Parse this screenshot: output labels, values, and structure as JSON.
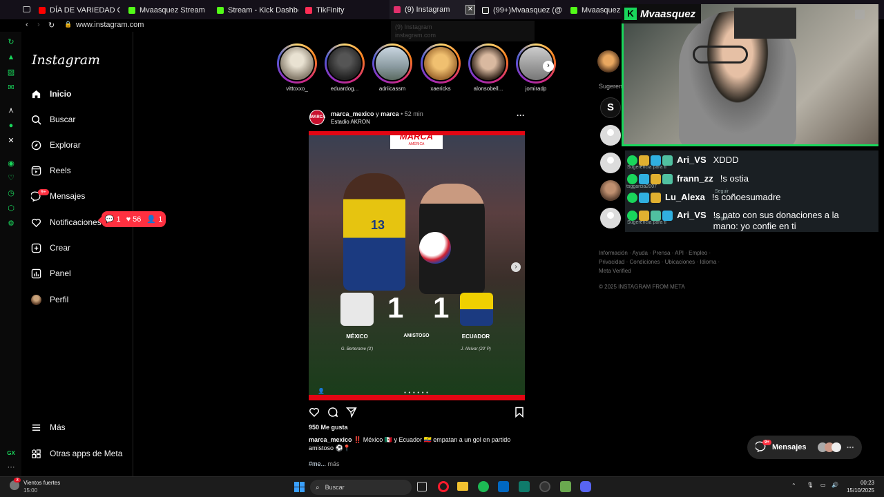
{
  "browser": {
    "tabs": [
      {
        "label": "DÍA DE VARIEDAD CARAJ",
        "icon": "youtube-icon",
        "color": "#ff0000"
      },
      {
        "label": "Mvaasquez Stream - Wat",
        "icon": "kick-icon",
        "color": "#53fc18"
      },
      {
        "label": "Stream - Kick Dashboard",
        "icon": "kick-icon",
        "color": "#53fc18"
      },
      {
        "label": "TikFinity",
        "icon": "tikfinity-icon",
        "color": "#ff2d55"
      },
      {
        "label": "(9) Instagram",
        "icon": "instagram-icon",
        "color": "#e1306c"
      },
      {
        "label": "(99+)Mvaasquez (@mvasq",
        "icon": "tiktok-icon",
        "color": "#ffffff"
      },
      {
        "label": "Mvaasquez Stre",
        "icon": "kick-icon",
        "color": "#53fc18"
      }
    ],
    "url": "www.instagram.com",
    "tab_hover_title": "(9) Instagram",
    "tab_hover_url": "instagram.com",
    "accent": "#18e66a"
  },
  "instagram": {
    "logo": "Instagram",
    "nav": [
      {
        "label": "Inicio",
        "icon": "home-icon"
      },
      {
        "label": "Buscar",
        "icon": "search-icon"
      },
      {
        "label": "Explorar",
        "icon": "compass-icon"
      },
      {
        "label": "Reels",
        "icon": "reels-icon"
      },
      {
        "label": "Mensajes",
        "icon": "messenger-icon"
      },
      {
        "label": "Notificaciones",
        "icon": "heart-icon"
      },
      {
        "label": "Crear",
        "icon": "plus-square-icon"
      },
      {
        "label": "Panel",
        "icon": "chart-icon"
      },
      {
        "label": "Perfil",
        "icon": "avatar-icon"
      },
      {
        "label": "Más",
        "icon": "menu-icon"
      },
      {
        "label": "Otras apps de Meta",
        "icon": "meta-apps-icon"
      }
    ],
    "messages_badge": "9+",
    "notif_pill": {
      "comments": "1",
      "likes": "56",
      "follows": "1"
    },
    "stories": [
      "vittoxxo_",
      "eduardog...",
      "adriicassm",
      "xaericks",
      "alonsobell...",
      "jomiradp"
    ],
    "post": {
      "author": "marca_mexico",
      "connector": "y",
      "coauthor": "marca",
      "time": "52 min",
      "location": "Estadio AKRON",
      "avatar_text": "MARCA",
      "image": {
        "brand": "MARCA",
        "brand_sub": "AMÉRICA",
        "score_left": "1",
        "score_right": "1",
        "team_left": "MÉXICO",
        "team_right": "ECUADOR",
        "match": "AMISTOSO",
        "scorer_left": "G. Berterame (3')",
        "scorer_right": "J. Alcívar (20' P)",
        "shirt_number": "13"
      },
      "likes": "950 Me gusta",
      "caption_user": "marca_mexico",
      "caption": "‼️ México 🇲🇽 y Ecuador 🇪🇨 empatan a un gol en partido amistoso ⚽️📍",
      "caption_tag": "#me...",
      "more": "más"
    },
    "suggestions_title": "Sugeren",
    "footer_links": "Información · Ayuda · Prensa · API · Empleo · Privacidad · Condiciones · Ubicaciones · Idioma · Meta Verified",
    "copyright": "© 2025 INSTAGRAM FROM META",
    "messages_button": "Mensajes",
    "messages_button_badge": "9+"
  },
  "stream": {
    "streamer": "Mvaasquez",
    "chat": [
      {
        "user": "Ari_VS",
        "message": "XDDD"
      },
      {
        "user": "frann_zz",
        "message": "!s ostia"
      },
      {
        "user": "Lu_Alexa",
        "message": "!s coñoesumadre"
      },
      {
        "user": "Ari_VS",
        "message": "!s pato con sus donaciones a la mano: yo confie en ti"
      }
    ],
    "ghost_texts": [
      "Sugerencia para ti",
      "tsggarcia2007",
      "Seguir",
      "Sugerencia para ti",
      "Seguir"
    ]
  },
  "taskbar": {
    "weather": "Vientos fuertes",
    "weather_time": "15:00",
    "weather_badge": "3",
    "search": "Buscar",
    "time": "00:23",
    "date": "15/10/2025"
  }
}
